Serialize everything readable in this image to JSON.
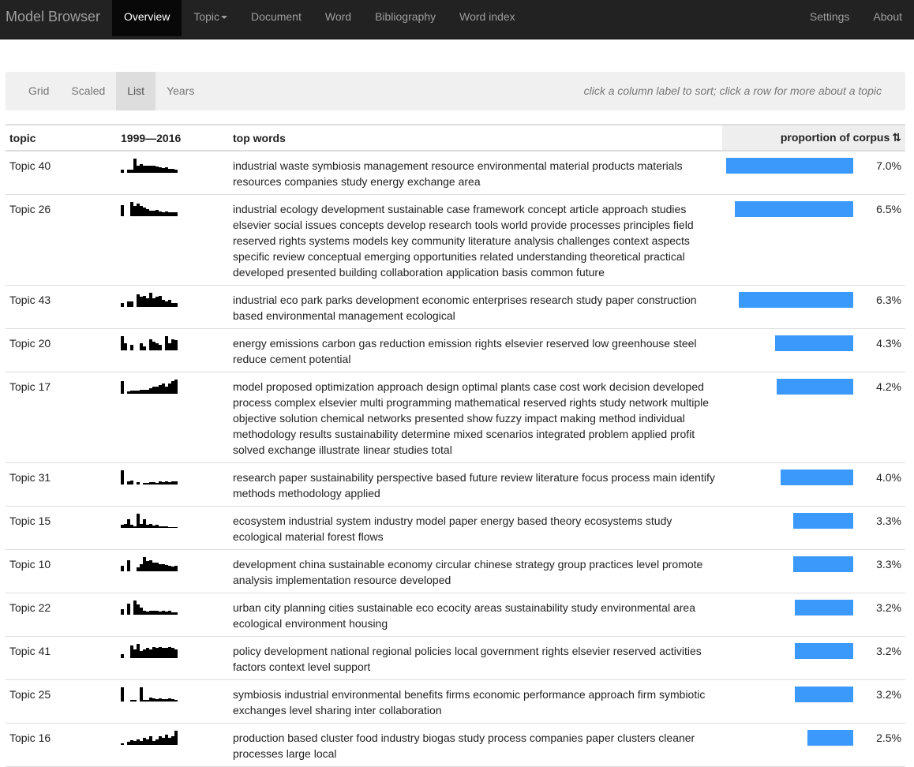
{
  "navbar": {
    "brand": "Model Browser",
    "left_items": [
      {
        "label": "Overview",
        "active": true
      },
      {
        "label": "Topic",
        "dropdown": true
      },
      {
        "label": "Document"
      },
      {
        "label": "Word"
      },
      {
        "label": "Bibliography"
      },
      {
        "label": "Word index"
      }
    ],
    "right_items": [
      {
        "label": "Settings"
      },
      {
        "label": "About"
      }
    ]
  },
  "subnav": {
    "tabs": [
      {
        "label": "Grid"
      },
      {
        "label": "Scaled"
      },
      {
        "label": "List",
        "active": true
      },
      {
        "label": "Years"
      }
    ],
    "hint": "click a column label to sort; click a row for more about a topic"
  },
  "table": {
    "headers": {
      "topic": "topic",
      "years": "1999—2016",
      "words": "top words",
      "proportion": "proportion of corpus",
      "sort_icon": "⇅"
    },
    "bar_color": "#3b99fc",
    "rows": [
      {
        "topic": "Topic 40",
        "words": "industrial waste symbiosis management resource environmental material products materials resources companies study energy exchange area",
        "proportion": "7.0%",
        "value": 7.0,
        "spark": [
          0.2,
          0,
          0.2,
          0.2,
          1,
          0.5,
          0.6,
          0.5,
          0.5,
          0.5,
          0.5,
          0.45,
          0.4,
          0.35,
          0.4,
          0.3,
          0.25,
          0.2
        ]
      },
      {
        "topic": "Topic 26",
        "words": "industrial ecology development sustainable case framework concept article approach studies elsevier social issues concepts develop research tools world provide processes principles field reserved rights systems models key community literature analysis challenges context aspects specific review conceptual emerging opportunities related understanding theoretical practical developed presented building collaboration application basis common future",
        "proportion": "6.5%",
        "value": 6.5,
        "spark": [
          0.8,
          0,
          0,
          1,
          0.7,
          0.9,
          0.7,
          0.6,
          0.5,
          0.4,
          0.4,
          0.45,
          0.35,
          0.3,
          0.35,
          0.3,
          0.3,
          0.3
        ]
      },
      {
        "topic": "Topic 43",
        "words": "industrial eco park parks development economic enterprises research study paper construction based environmental management ecological",
        "proportion": "6.3%",
        "value": 6.3,
        "spark": [
          0.3,
          0,
          0.4,
          0.4,
          0,
          0.9,
          0.7,
          0.8,
          0.6,
          1,
          0.6,
          0.7,
          0.8,
          0.5,
          0.4,
          0.5,
          0.3,
          0.25
        ]
      },
      {
        "topic": "Topic 20",
        "words": "energy emissions carbon gas reduction emission rights elsevier reserved low greenhouse steel reduce cement potential",
        "proportion": "4.3%",
        "value": 4.3,
        "spark": [
          1,
          0.5,
          0,
          0.4,
          0,
          0,
          0.5,
          0.3,
          0,
          0.8,
          0.6,
          0.5,
          0.4,
          0,
          1,
          0.5,
          0.8,
          0.7
        ]
      },
      {
        "topic": "Topic 17",
        "words": "model proposed optimization approach design optimal plants case cost work decision developed process complex elsevier multi programming mathematical reserved rights study network multiple objective solution chemical networks presented show fuzzy impact making method individual methodology results sustainability determine mixed scenarios integrated problem applied profit solved exchange illustrate linear studies total",
        "proportion": "4.2%",
        "value": 4.2,
        "spark": [
          0.9,
          0,
          0.15,
          0.2,
          0.2,
          0.2,
          0.25,
          0.3,
          0.3,
          0.4,
          0.5,
          0.5,
          0.6,
          0.7,
          0.5,
          0.7,
          0.9,
          1
        ]
      },
      {
        "topic": "Topic 31",
        "words": "research paper sustainability perspective based future review literature focus process main identify methods methodology applied",
        "proportion": "4.0%",
        "value": 4.0,
        "spark": [
          1,
          0,
          0.2,
          0.25,
          0,
          0.15,
          0,
          0.1,
          0.1,
          0.15,
          0.15,
          0.1,
          0.2,
          0.15,
          0.2,
          0.15,
          0.2,
          0.2
        ]
      },
      {
        "topic": "Topic 15",
        "words": "ecosystem industrial system industry model paper energy based theory ecosystems study ecological material forest flows",
        "proportion": "3.3%",
        "value": 3.3,
        "spark": [
          0.2,
          0.25,
          0.6,
          0.2,
          0.1,
          1,
          0.3,
          0.6,
          0.2,
          0.25,
          0.15,
          0.2,
          0.1,
          0.1,
          0.1,
          0.05,
          0.05,
          0.05
        ]
      },
      {
        "topic": "Topic 10",
        "words": "development china sustainable economy circular chinese strategy group practices level promote analysis implementation resource developed",
        "proportion": "3.3%",
        "value": 3.3,
        "spark": [
          0.4,
          0,
          0.8,
          0,
          0,
          0.3,
          0.5,
          1,
          0.7,
          0.8,
          0.6,
          0.6,
          0.5,
          0.5,
          0.45,
          0.4,
          0.35,
          0.4
        ]
      },
      {
        "topic": "Topic 22",
        "words": "urban city planning cities sustainable eco ecocity areas sustainability study environmental area ecological environment housing",
        "proportion": "3.2%",
        "value": 3.2,
        "spark": [
          0.4,
          0,
          0.8,
          0,
          1,
          0.7,
          0.5,
          0.3,
          0.2,
          0.3,
          0.25,
          0.3,
          0.2,
          0.25,
          0.2,
          0.25,
          0.15,
          0.15
        ]
      },
      {
        "topic": "Topic 41",
        "words": "policy development national regional policies local government rights elsevier reserved activities factors context level support",
        "proportion": "3.2%",
        "value": 3.2,
        "spark": [
          0.3,
          0,
          0,
          0.9,
          0.6,
          1,
          0.5,
          0.6,
          0.7,
          0.6,
          0.8,
          0.7,
          0.8,
          0.7,
          0.7,
          0.8,
          0.7,
          0.6
        ]
      },
      {
        "topic": "Topic 25",
        "words": "symbiosis industrial environmental benefits firms economic performance approach firm symbiotic exchanges level sharing inter collaboration",
        "proportion": "3.2%",
        "value": 3.2,
        "spark": [
          1,
          0,
          0,
          0.1,
          0.1,
          0,
          1,
          0.1,
          0.1,
          0.3,
          0.2,
          0.15,
          0.2,
          0.15,
          0.15,
          0.2,
          0.15,
          0.1
        ]
      },
      {
        "topic": "Topic 16",
        "words": "production based cluster food industry biogas study process companies paper clusters cleaner processes large local",
        "proportion": "2.5%",
        "value": 2.5,
        "spark": [
          0.1,
          0,
          0.2,
          0.35,
          0.3,
          0.4,
          0.3,
          0.5,
          0.4,
          0.6,
          0.3,
          0.4,
          0.6,
          0.5,
          0.7,
          0.5,
          0.6,
          1
        ]
      }
    ]
  }
}
